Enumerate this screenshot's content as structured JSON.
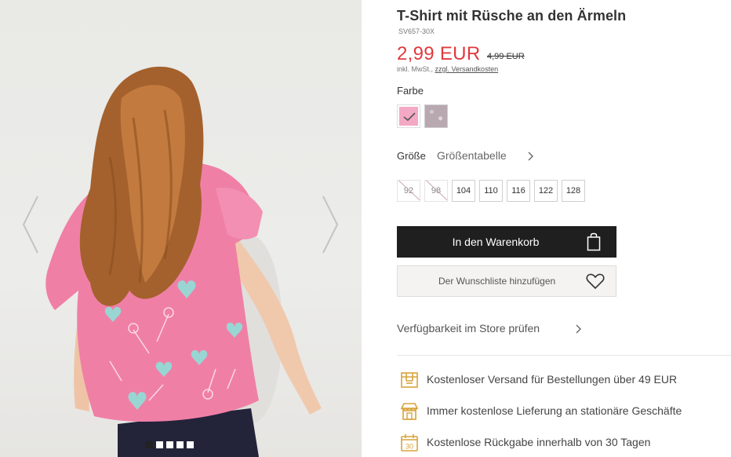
{
  "product": {
    "title": "T-Shirt mit Rüsche an den Ärmeln",
    "sku": "SV657-30X",
    "price": "2,99 EUR",
    "old_price": "4,99 EUR",
    "tax_note": "inkl. MwSt.,",
    "shipping_link": "zzgl. Versandkosten"
  },
  "colors": {
    "label": "Farbe",
    "options": [
      {
        "name": "pink",
        "hex": "#f3a9c4",
        "selected": true
      },
      {
        "name": "grey-pattern",
        "hex": "#b8a8b0",
        "selected": false
      }
    ]
  },
  "sizes": {
    "label": "Größe",
    "chart_link": "Größentabelle",
    "options": [
      {
        "label": "92",
        "available": false
      },
      {
        "label": "98",
        "available": false
      },
      {
        "label": "104",
        "available": true
      },
      {
        "label": "110",
        "available": true
      },
      {
        "label": "116",
        "available": true
      },
      {
        "label": "122",
        "available": true
      },
      {
        "label": "128",
        "available": true
      }
    ]
  },
  "actions": {
    "add_to_cart": "In den Warenkorb",
    "wishlist": "Der Wunschliste hinzufügen",
    "store_availability": "Verfügbarkeit im Store prüfen"
  },
  "benefits": [
    {
      "icon": "delivery-box-icon",
      "text": "Kostenloser Versand für Bestellungen über 49 EUR"
    },
    {
      "icon": "store-icon",
      "text": "Immer kostenlose Lieferung an stationäre Geschäfte"
    },
    {
      "icon": "calendar-30-icon",
      "text": "Kostenlose Rückgabe innerhalb von 30 Tagen",
      "badge": "30"
    }
  ],
  "gallery": {
    "image_count": 5,
    "active_index": 0
  },
  "colors_theme": {
    "price_red": "#e0393e",
    "button_dark": "#1f1f1f",
    "icon_gold": "#d8a33a"
  }
}
